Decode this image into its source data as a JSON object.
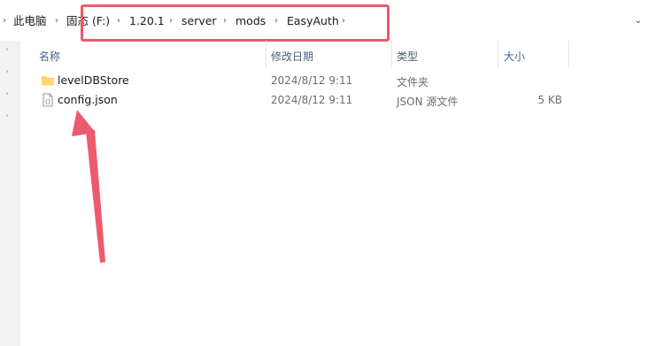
{
  "breadcrumb": {
    "items": [
      {
        "label": "此电脑"
      },
      {
        "label": "固态 (F:)"
      },
      {
        "label": "1.20.1"
      },
      {
        "label": "server"
      },
      {
        "label": "mods"
      },
      {
        "label": "EasyAuth"
      }
    ]
  },
  "columns": {
    "name": "名称",
    "modified": "修改日期",
    "type": "类型",
    "size": "大小"
  },
  "files": [
    {
      "name": "levelDBStore",
      "modified": "2024/8/12 9:11",
      "type": "文件夹",
      "size": "",
      "icon": "folder-icon"
    },
    {
      "name": "config.json",
      "modified": "2024/8/12 9:11",
      "type": "JSON 源文件",
      "size": "5 KB",
      "icon": "json-file-icon"
    }
  ],
  "annotation_colors": {
    "box": "#ec5a6d",
    "arrow": "#ec5a6d"
  }
}
